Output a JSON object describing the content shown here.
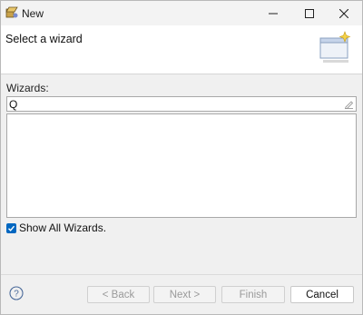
{
  "window": {
    "title": "New",
    "controls": {
      "minimize_icon": "minimize-icon",
      "maximize_icon": "maximize-icon",
      "close_icon": "close-icon"
    }
  },
  "header": {
    "title": "Select a wizard",
    "graphic_icon": "new-wizard-banner-icon"
  },
  "body": {
    "wizards_label": "Wizards:",
    "filter": {
      "value": "Q",
      "clear_icon": "clear-filter-icon"
    },
    "wizard_list": [],
    "show_all_wizards": {
      "label": "Show All Wizards.",
      "checked": true
    }
  },
  "footer": {
    "help_icon": "help-icon",
    "buttons": {
      "back": "< Back",
      "next": "Next >",
      "finish": "Finish",
      "cancel": "Cancel"
    }
  },
  "colors": {
    "accent": "#0067c0",
    "disabled_text": "#9a9a9a"
  }
}
